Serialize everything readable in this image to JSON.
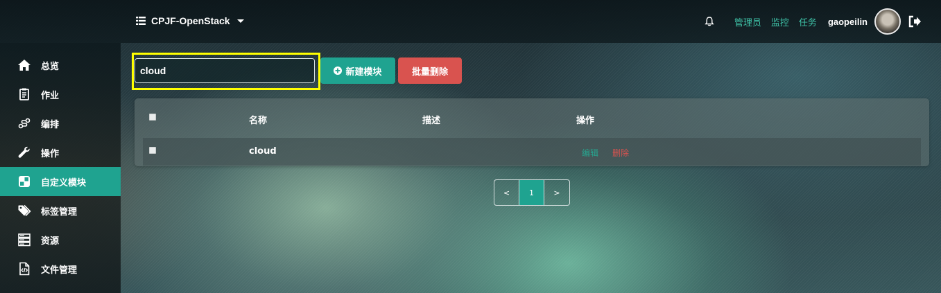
{
  "header": {
    "project_name": "CPJF-OpenStack",
    "links": [
      "管理员",
      "监控",
      "任务"
    ],
    "username": "gaopeilin"
  },
  "sidebar": {
    "items": [
      {
        "label": "总览",
        "icon": "home-icon"
      },
      {
        "label": "作业",
        "icon": "clipboard-icon"
      },
      {
        "label": "编排",
        "icon": "link-icon"
      },
      {
        "label": "操作",
        "icon": "wrench-icon"
      },
      {
        "label": "自定义模块",
        "icon": "puzzle-icon",
        "active": true
      },
      {
        "label": "标签管理",
        "icon": "tags-icon"
      },
      {
        "label": "资源",
        "icon": "server-icon"
      },
      {
        "label": "文件管理",
        "icon": "file-code-icon"
      }
    ]
  },
  "toolbar": {
    "search_value": "cloud",
    "new_button": "新建模块",
    "bulk_delete_button": "批量删除"
  },
  "table": {
    "columns": [
      "名称",
      "描述",
      "操作"
    ],
    "rows": [
      {
        "name": "cloud",
        "description": "",
        "edit": "编辑",
        "delete": "删除"
      }
    ]
  },
  "pagination": {
    "prev": "<",
    "current": "1",
    "next": ">"
  },
  "colors": {
    "accent": "#1fa390",
    "danger": "#d9534f",
    "highlight": "#ffff00",
    "link": "#3fc3a8"
  }
}
